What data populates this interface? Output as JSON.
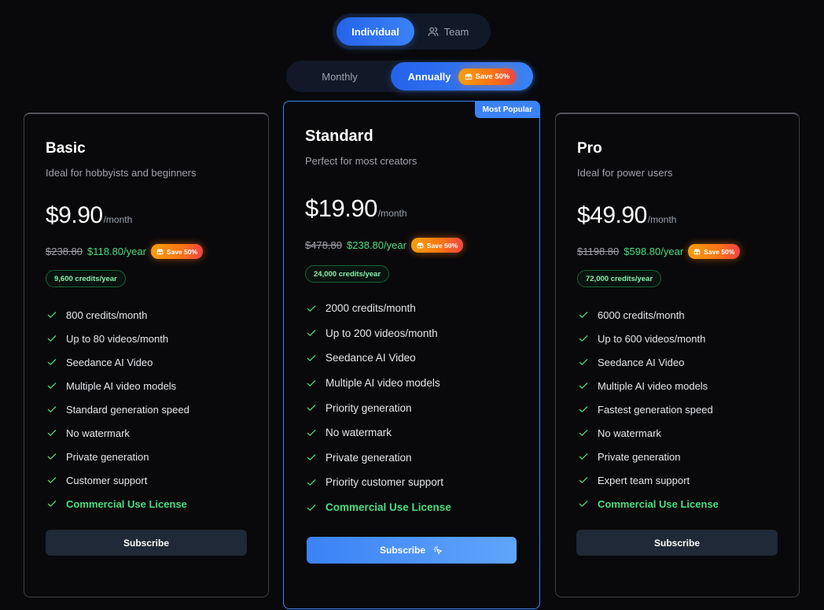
{
  "audience_toggle": {
    "individual_label": "Individual",
    "team_label": "Team",
    "team_icon": "users-icon",
    "selected": "Individual"
  },
  "billing_toggle": {
    "monthly_label": "Monthly",
    "annually_label": "Annually",
    "save_badge": "Save 50%",
    "save_icon": "gift-icon",
    "selected": "Annually"
  },
  "plans": [
    {
      "name": "Basic",
      "description": "Ideal for hobbyists and beginners",
      "price": "$9.90",
      "per": "/month",
      "old_yearly": "$238.80",
      "new_yearly": "$118.80/year",
      "save_badge": "Save 50%",
      "credits_badge": "9,600 credits/year",
      "features": [
        "800 credits/month",
        "Up to 80 videos/month",
        "Seedance AI Video",
        "Multiple AI video models",
        "Standard generation speed",
        "No watermark",
        "Private generation",
        "Customer support",
        "Commercial Use License"
      ],
      "button": "Subscribe"
    },
    {
      "name": "Standard",
      "tag": "Most Popular",
      "description": "Perfect for most creators",
      "price": "$19.90",
      "per": "/month",
      "old_yearly": "$478.80",
      "new_yearly": "$238.80/year",
      "save_badge": "Save 50%",
      "credits_badge": "24,000 credits/year",
      "features": [
        "2000 credits/month",
        "Up to 200 videos/month",
        "Seedance AI Video",
        "Multiple AI video models",
        "Priority generation",
        "No watermark",
        "Private generation",
        "Priority customer support",
        "Commercial Use License"
      ],
      "button": "Subscribe"
    },
    {
      "name": "Pro",
      "description": "Ideal for power users",
      "price": "$49.90",
      "per": "/month",
      "old_yearly": "$1198.80",
      "new_yearly": "$598.80/year",
      "save_badge": "Save 50%",
      "credits_badge": "72,000 credits/year",
      "features": [
        "6000 credits/month",
        "Up to 600 videos/month",
        "Seedance AI Video",
        "Multiple AI video models",
        "Fastest generation speed",
        "No watermark",
        "Private generation",
        "Expert team support",
        "Commercial Use License"
      ],
      "button": "Subscribe"
    }
  ],
  "colors": {
    "background": "#09090b",
    "accent": "#3b82f6",
    "check": "#4ade80",
    "badge_gradient_start": "#f59e0b",
    "badge_gradient_end": "#ef4444"
  }
}
